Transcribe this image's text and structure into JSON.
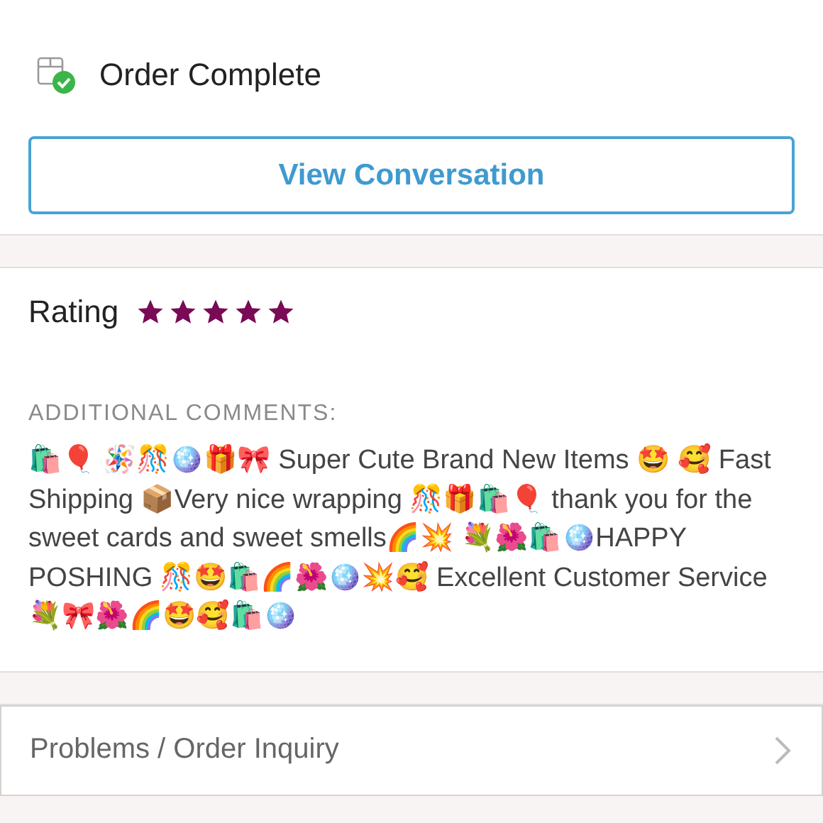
{
  "order_status": {
    "label": "Order Complete"
  },
  "view_conversation_button": {
    "label": "View Conversation"
  },
  "rating": {
    "label": "Rating",
    "stars": 5
  },
  "comments": {
    "heading": "ADDITIONAL COMMENTS:",
    "text": "🛍🎈 🪅🎊🪩🎁🎀 Super Cute Brand New Items 🤩 🥰 Fast Shipping 📦Very nice wrapping 🎊🎁🛍🎈 thank you for the sweet cards and sweet smells🌈💥 💐🌺🛍🪩HAPPY POSHING 🎊🤩🛍🌈🌺🪩💥🥰 Excellent Customer Service 💐🎀🌺🌈🤩🥰🛍🪩"
  },
  "problems_row": {
    "label": "Problems / Order Inquiry"
  }
}
